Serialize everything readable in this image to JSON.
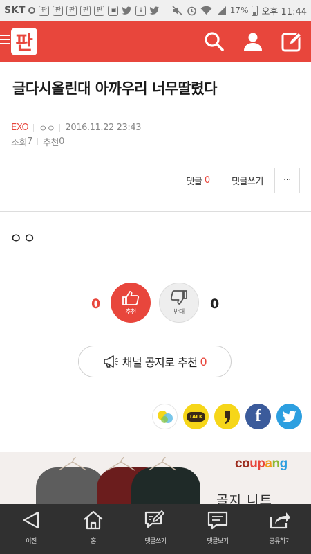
{
  "status_bar": {
    "carrier": "SKT",
    "battery": "17%",
    "time": "오후 11:44"
  },
  "header": {
    "logo_text": "판",
    "icons": [
      "menu-icon",
      "search-icon",
      "user-icon",
      "write-icon"
    ]
  },
  "article": {
    "title": "글다시올린대 아까우리 너무딸렸다",
    "category": "EXO",
    "author": "ㅇㅇ",
    "datetime": "2016.11.22 23:43",
    "views_label": "조회",
    "views": "7",
    "recommend_label": "추천",
    "recommend": "0",
    "body": "ㅇㅇ"
  },
  "actions": {
    "comment_label": "댓글",
    "comment_count": "0",
    "write_comment": "댓글쓰기",
    "more": "···"
  },
  "vote": {
    "up_count": "0",
    "up_label": "추천",
    "down_count": "0",
    "down_label": "반대"
  },
  "channel": {
    "label": "채널 공지로 추천",
    "count": "0"
  },
  "share": {
    "talk_label": "TALK",
    "facebook_label": "f"
  },
  "ad": {
    "brand": "coupang",
    "headline": "골지 니트",
    "brand_colors": [
      "#9b2c1e",
      "#e8463c",
      "#f29a1d",
      "#8cb832",
      "#2d9fe0"
    ]
  },
  "bottom_nav": [
    {
      "label": "이전",
      "icon": "back-icon"
    },
    {
      "label": "홈",
      "icon": "home-icon"
    },
    {
      "label": "댓글쓰기",
      "icon": "write-comment-icon"
    },
    {
      "label": "댓글보기",
      "icon": "view-comments-icon"
    },
    {
      "label": "공유하기",
      "icon": "share-icon"
    }
  ],
  "colors": {
    "accent": "#e8463c",
    "nav_bg": "#303030"
  }
}
